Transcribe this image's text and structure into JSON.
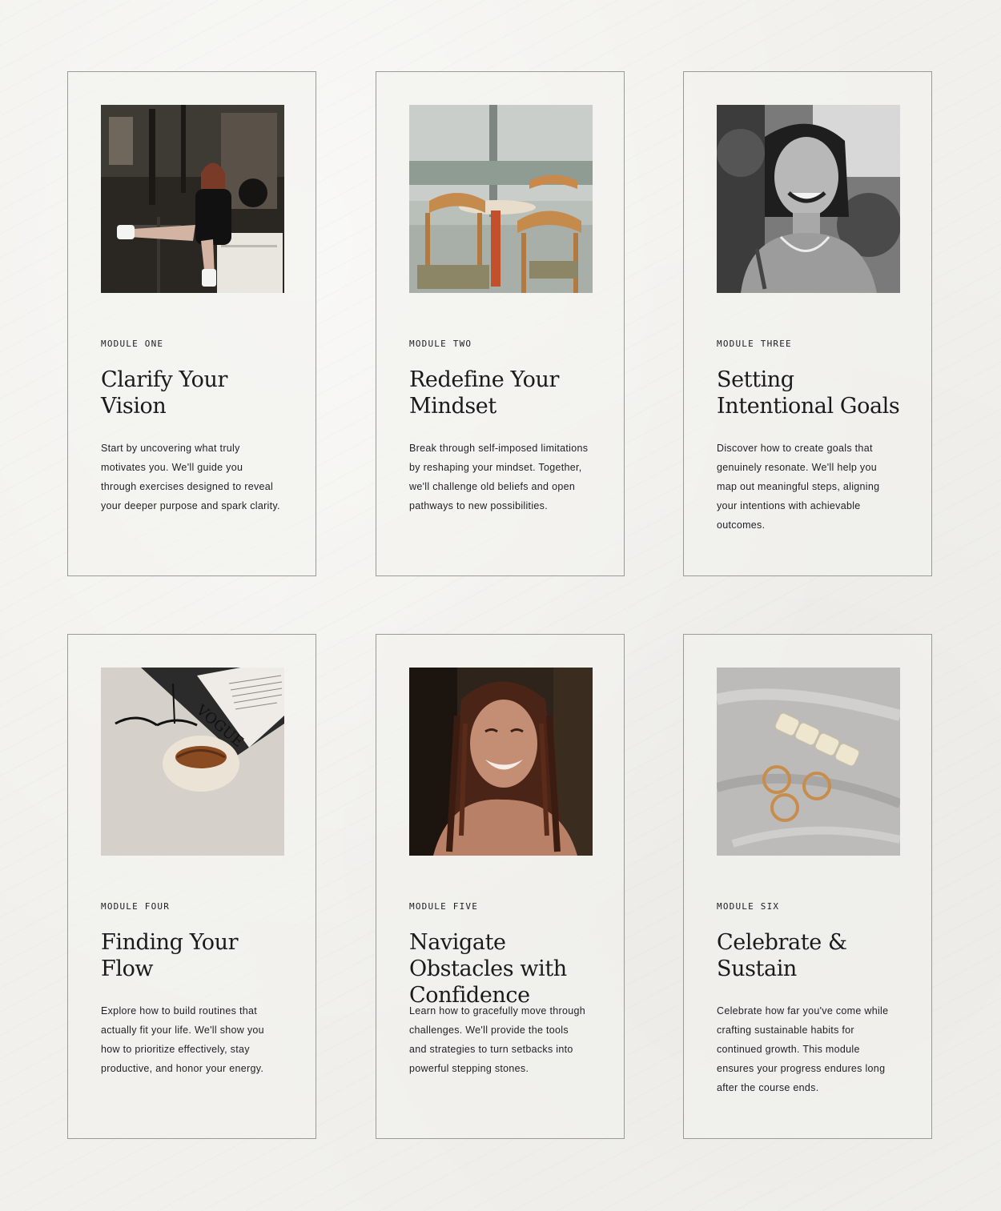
{
  "modules": [
    {
      "label": "MODULE ONE",
      "title": "Clarify Your Vision",
      "description": "Start by uncovering what truly motivates you. We'll guide you through exercises designed to reveal your deeper purpose and spark clarity.",
      "image": "woman-seated-in-cafe-photo"
    },
    {
      "label": "MODULE TWO",
      "title": "Redefine Your Mindset",
      "description": "Break through self-imposed limitations by reshaping your mindset. Together, we'll challenge old beliefs and open pathways to new possibilities.",
      "image": "cafe-chairs-and-table-photo"
    },
    {
      "label": "MODULE THREE",
      "title": "Setting Intentional Goals",
      "description": "Discover how to create goals that genuinely resonate. We'll help you map out meaningful steps, aligning your intentions with achievable outcomes.",
      "image": "smiling-woman-black-and-white-photo"
    },
    {
      "label": "MODULE FOUR",
      "title": "Finding Your Flow",
      "description": "Explore how to build routines that actually fit your life. We'll show you how to prioritize effectively, stay productive, and honor your energy.",
      "image": "croissant-sunglasses-magazine-photo",
      "magazine_text": "VOGUE"
    },
    {
      "label": "MODULE FIVE",
      "title": "Navigate Obstacles with Confidence",
      "description": "Learn how to gracefully move through challenges. We'll provide the tools and strategies to turn setbacks into powerful stepping stones.",
      "image": "laughing-woman-braids-photo"
    },
    {
      "label": "MODULE SIX",
      "title": "Celebrate & Sustain",
      "description": "Celebrate how far you've come while crafting sustainable habits for continued growth. This module ensures your progress endures long after the course ends.",
      "image": "gold-rings-and-hair-clip-photo"
    }
  ],
  "colors": {
    "background": "#f1f0ec",
    "card_border": "#9a9a96",
    "text": "#1c1c1c"
  }
}
